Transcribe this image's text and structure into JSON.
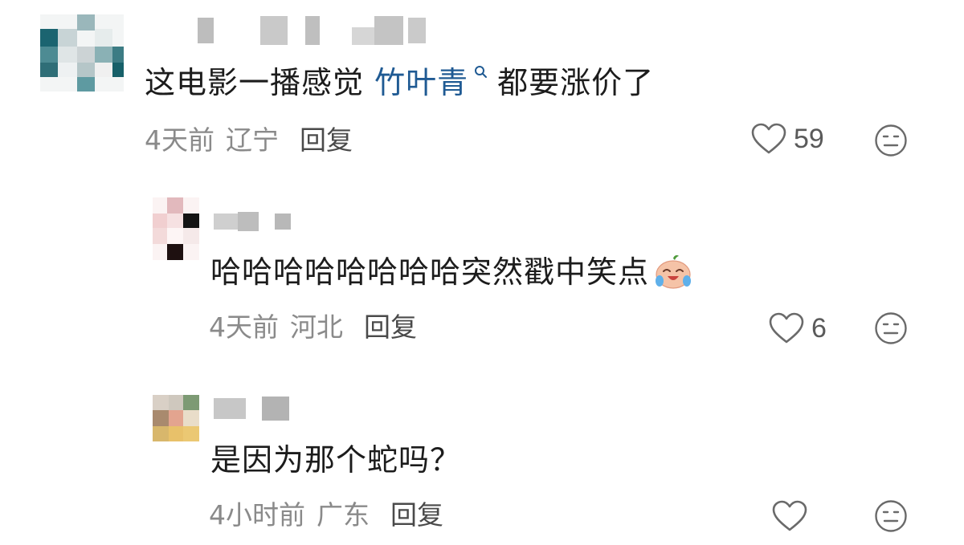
{
  "comments": [
    {
      "text_prefix": "这电影一播感觉 ",
      "link_text": "竹叶青",
      "text_suffix": "都要涨价了",
      "time": "4天前",
      "location": "辽宁",
      "reply_label": "回复",
      "likes": "59"
    },
    {
      "text": "哈哈哈哈哈哈哈哈突然戳中笑点",
      "time": "4天前",
      "location": "河北",
      "reply_label": "回复",
      "likes": "6"
    },
    {
      "text": "是因为那个蛇吗？",
      "time": "4小时前",
      "location": "广东",
      "reply_label": "回复",
      "likes": ""
    }
  ],
  "icons": {
    "like": "heart-outline-icon",
    "dislike": "neutral-face-icon",
    "search": "search-icon",
    "emoji": "laughing-crying-emoji"
  },
  "colors": {
    "link": "#1f5a93",
    "meta": "#8a8a8a",
    "reply": "#4a4a4a"
  }
}
